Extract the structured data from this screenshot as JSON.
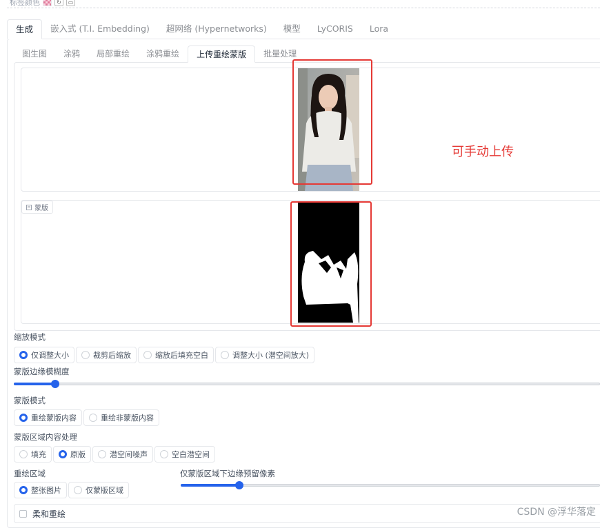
{
  "top": {
    "label": "标签颜色",
    "refresh_icon": "refresh-icon",
    "save_icon": "save-icon"
  },
  "main_tabs": [
    "生成",
    "嵌入式 (T.I. Embedding)",
    "超网络 (Hypernetworks)",
    "模型",
    "LyCORIS",
    "Lora"
  ],
  "main_tab_active": 0,
  "sub_tabs": [
    "图生图",
    "涂鸦",
    "局部重绘",
    "涂鸦重绘",
    "上传重绘蒙版",
    "批量处理"
  ],
  "sub_tab_active": 4,
  "mask_label": "蒙版",
  "annotation": "可手动上传",
  "resize_mode": {
    "label": "缩放模式",
    "options": [
      "仅调整大小",
      "裁剪后缩放",
      "缩放后填充空白",
      "调整大小 (潜空间放大)"
    ],
    "selected": 0
  },
  "mask_blur": {
    "label": "蒙版边缘模糊度",
    "fraction": 0.07
  },
  "mask_mode": {
    "label": "蒙版模式",
    "options": [
      "重绘蒙版内容",
      "重绘非蒙版内容"
    ],
    "selected": 0
  },
  "masked_content": {
    "label": "蒙版区域内容处理",
    "options": [
      "填充",
      "原版",
      "潜空间噪声",
      "空白潜空间"
    ],
    "selected": 1
  },
  "inpaint_area": {
    "label": "重绘区域",
    "options": [
      "整张图片",
      "仅蒙版区域"
    ],
    "selected": 0
  },
  "padding": {
    "label": "仅蒙版区域下边缘预留像素",
    "fraction": 0.14
  },
  "soft_inpaint": {
    "label": "柔和重绘"
  },
  "watermark": "CSDN @浮华落定",
  "colors": {
    "accent": "#2563eb",
    "annotation": "#e53935"
  }
}
